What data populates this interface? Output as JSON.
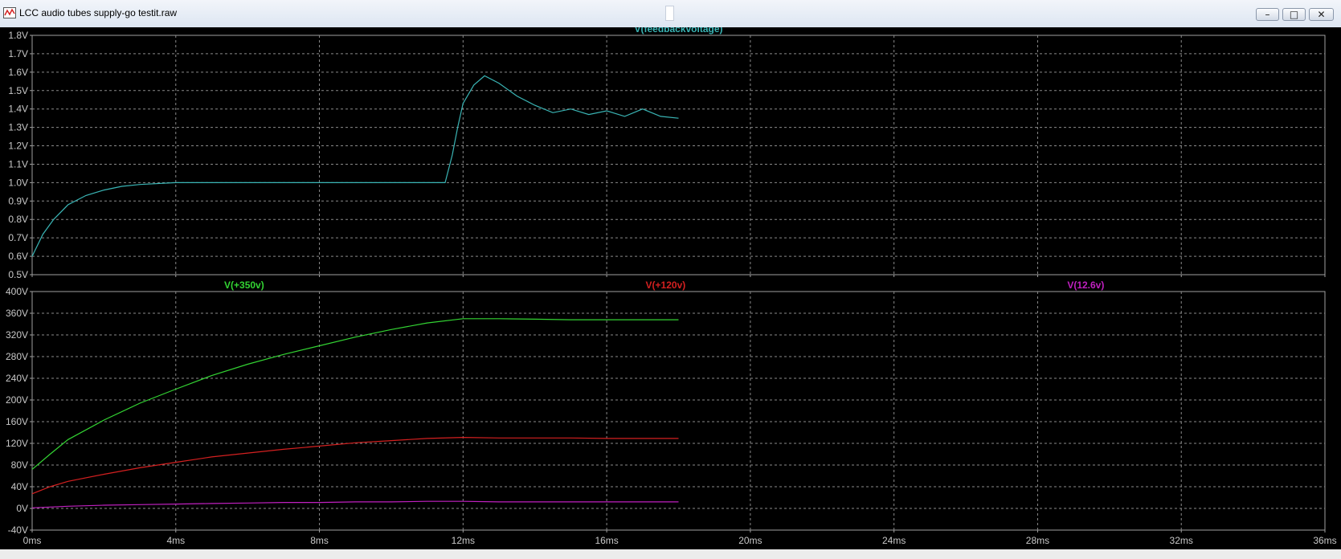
{
  "window": {
    "title": "LCC audio tubes supply-go testit.raw",
    "buttons": {
      "minimize": "–",
      "maximize": "□",
      "close": "✕"
    }
  },
  "chart_data": [
    {
      "type": "line",
      "title": "V(feedbackvoltage)",
      "x_unit": "ms",
      "xlim": [
        0,
        36
      ],
      "ylim": [
        0.5,
        1.8
      ],
      "y_unit": "V",
      "grid": true,
      "x_ticks": [
        "0ms",
        "4ms",
        "8ms",
        "12ms",
        "16ms",
        "20ms",
        "24ms",
        "28ms",
        "32ms",
        "36ms"
      ],
      "y_ticks": [
        "0.5V",
        "0.6V",
        "0.7V",
        "0.8V",
        "0.9V",
        "1.0V",
        "1.1V",
        "1.2V",
        "1.3V",
        "1.4V",
        "1.5V",
        "1.6V",
        "1.7V",
        "1.8V"
      ],
      "series": [
        {
          "name": "V(feedbackvoltage)",
          "color": "#3ab5b5",
          "x": [
            0,
            0.3,
            0.6,
            1.0,
            1.5,
            2.0,
            2.5,
            3.0,
            4.0,
            5.0,
            8.0,
            11.5,
            11.7,
            11.85,
            12.0,
            12.3,
            12.6,
            13.0,
            13.5,
            14.0,
            14.5,
            15.0,
            15.5,
            16.0,
            16.5,
            17.0,
            17.5,
            18.0
          ],
          "y": [
            0.6,
            0.72,
            0.8,
            0.88,
            0.93,
            0.96,
            0.98,
            0.99,
            1.0,
            1.0,
            1.0,
            1.0,
            1.15,
            1.3,
            1.43,
            1.53,
            1.58,
            1.54,
            1.47,
            1.42,
            1.38,
            1.4,
            1.37,
            1.39,
            1.36,
            1.4,
            1.36,
            1.35
          ]
        }
      ]
    },
    {
      "type": "line",
      "x_unit": "ms",
      "xlim": [
        0,
        36
      ],
      "ylim": [
        -40,
        400
      ],
      "y_unit": "V",
      "grid": true,
      "x_ticks": [
        "0ms",
        "4ms",
        "8ms",
        "12ms",
        "16ms",
        "20ms",
        "24ms",
        "28ms",
        "32ms",
        "36ms"
      ],
      "y_ticks": [
        "-40V",
        "0V",
        "40V",
        "80V",
        "120V",
        "160V",
        "200V",
        "240V",
        "280V",
        "320V",
        "360V",
        "400V"
      ],
      "series": [
        {
          "name": "V(+350v)",
          "color": "#33d433",
          "x": [
            0,
            0.5,
            1,
            2,
            3,
            4,
            5,
            6,
            7,
            8,
            9,
            10,
            11,
            12,
            13,
            14,
            15,
            16,
            17,
            18
          ],
          "y": [
            72,
            100,
            127,
            163,
            194,
            220,
            245,
            266,
            284,
            300,
            316,
            330,
            342,
            350,
            350,
            349,
            348,
            348,
            348,
            348
          ]
        },
        {
          "name": "V(+120v)",
          "color": "#d42020",
          "x": [
            0,
            0.5,
            1,
            2,
            3,
            4,
            5,
            6,
            7,
            8,
            9,
            10,
            11,
            12,
            13,
            14,
            15,
            16,
            17,
            18
          ],
          "y": [
            27,
            40,
            50,
            63,
            75,
            85,
            95,
            102,
            109,
            115,
            121,
            125,
            129,
            131,
            130,
            130,
            130,
            129,
            129,
            129
          ]
        },
        {
          "name": "V(12.6v)",
          "color": "#c020c0",
          "x": [
            0,
            1,
            2,
            3,
            4,
            5,
            6,
            7,
            8,
            9,
            10,
            11,
            12,
            13,
            14,
            15,
            16,
            17,
            18
          ],
          "y": [
            1,
            4,
            6,
            7,
            8,
            9,
            10,
            11,
            11,
            12,
            12,
            13,
            13,
            12,
            12,
            12,
            12,
            12,
            12
          ]
        }
      ]
    }
  ]
}
